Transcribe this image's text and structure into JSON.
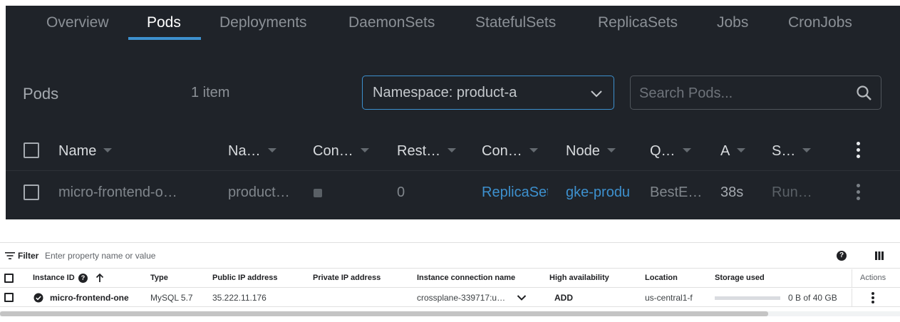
{
  "lens": {
    "tabs": [
      "Overview",
      "Pods",
      "Deployments",
      "DaemonSets",
      "StatefulSets",
      "ReplicaSets",
      "Jobs",
      "CronJobs"
    ],
    "active_tab": "Pods",
    "title": "Pods",
    "item_count": "1 item",
    "namespace_select": "Namespace: product-a",
    "search_placeholder": "Search Pods...",
    "columns": [
      "Name",
      "Na…",
      "Con…",
      "Rest…",
      "Con…",
      "Node",
      "Q…",
      "A",
      "S…"
    ],
    "row": {
      "name": "micro-frontend-o…",
      "namespace": "product…",
      "restarts": "0",
      "controlled_by": "ReplicaSet",
      "node": "gke-produ",
      "qos": "BestE…",
      "age": "38s",
      "status": "Run…"
    },
    "colors": {
      "background": "#1f2329",
      "accent": "#3d90ce"
    }
  },
  "sql": {
    "filter_label": "Filter",
    "filter_placeholder": "Enter property name or value",
    "columns": {
      "instance_id": "Instance ID",
      "type": "Type",
      "public_ip": "Public IP address",
      "private_ip": "Private IP address",
      "connection_name": "Instance connection name",
      "high_availability": "High availability",
      "location": "Location",
      "storage": "Storage used",
      "actions": "Actions"
    },
    "row": {
      "instance_id": "micro-frontend-one",
      "type": "MySQL 5.7",
      "public_ip": "35.222.11.176",
      "private_ip": "",
      "connection_name": "crossplane-339717:u…",
      "high_availability": "ADD",
      "location": "us-central1-f",
      "storage_used": "0 B of 40 GB",
      "storage_fraction": 0
    },
    "icons": [
      "filter-icon",
      "help-icon",
      "column-display-icon",
      "sort-up-arrow-icon",
      "check-circle-icon",
      "expand-chevron-icon",
      "more-vert-icon"
    ]
  }
}
